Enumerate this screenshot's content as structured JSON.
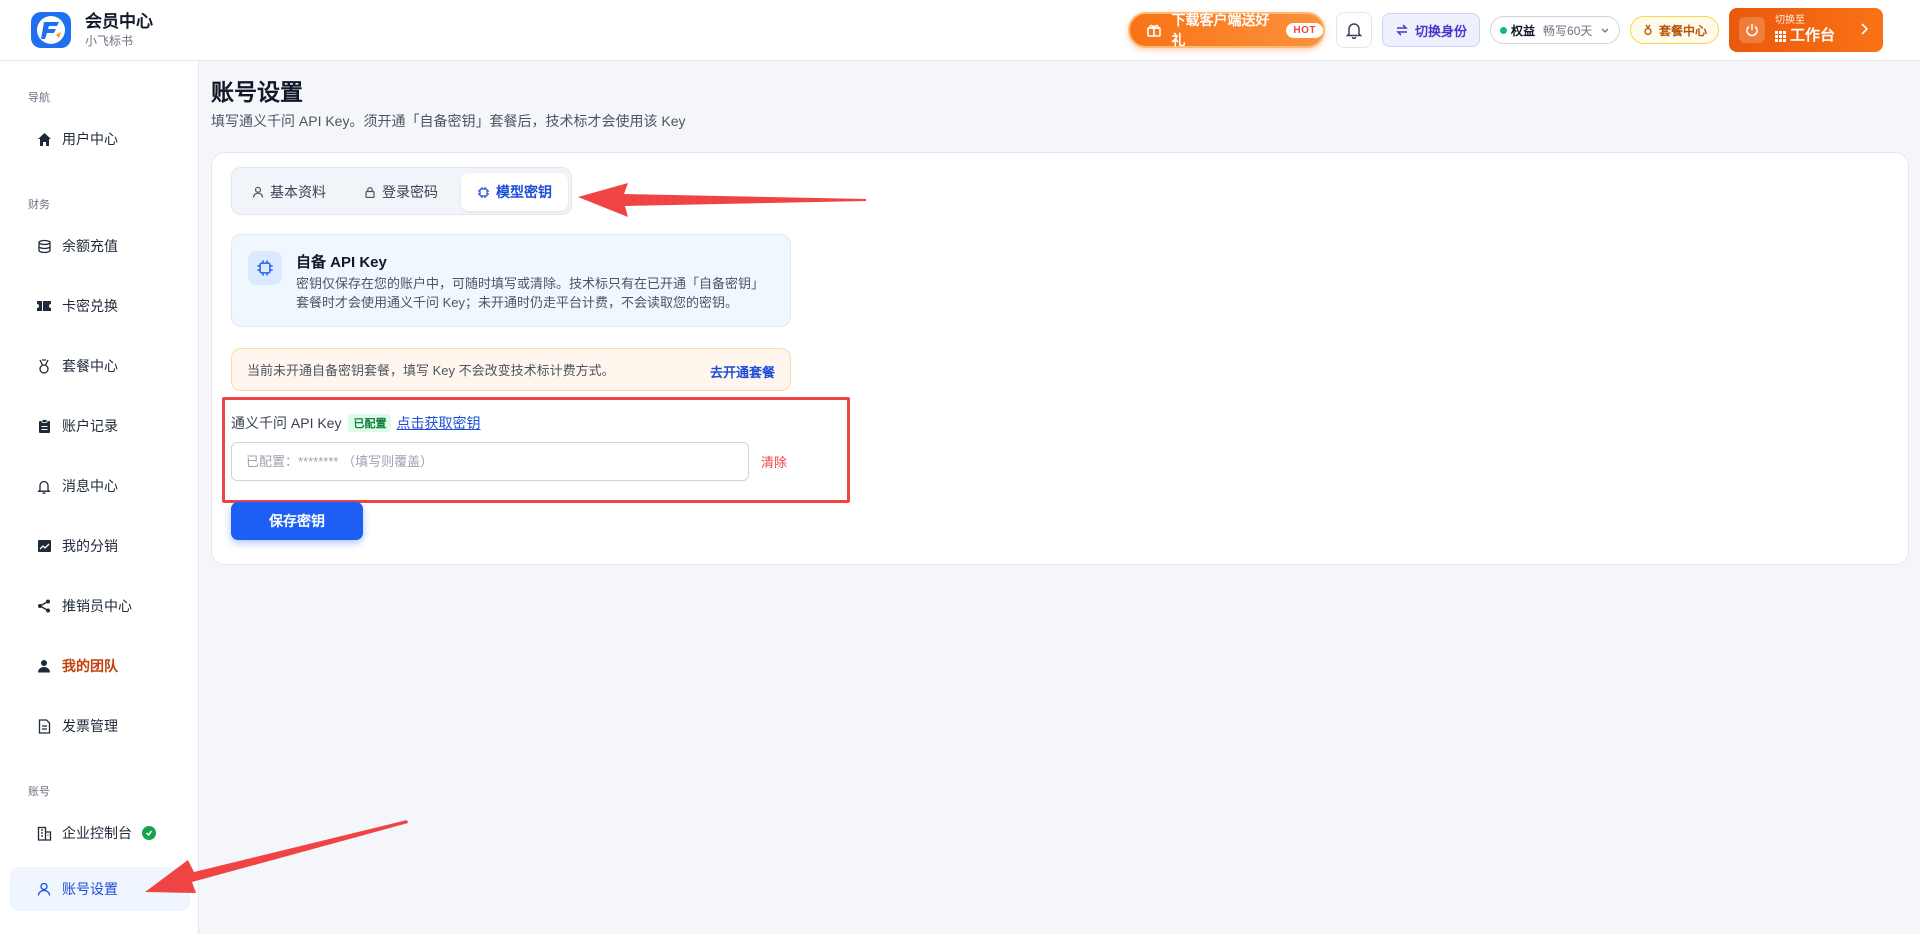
{
  "brand": {
    "title": "会员中心",
    "subtitle": "小飞标书"
  },
  "header": {
    "promo_label": "下载客户端送好礼",
    "promo_badge": "HOT",
    "switch_label": "切换身份",
    "rights_label": "权益",
    "rights_value": "畅写60天",
    "package_label": "套餐中心",
    "workspace_small": "切换至",
    "workspace_big": "工作台"
  },
  "sidebar": {
    "sections": {
      "nav": "导航",
      "finance": "财务",
      "account": "账号"
    },
    "items": [
      {
        "label": "用户中心",
        "icon": "home-icon"
      },
      {
        "label": "余额充值",
        "icon": "database-icon"
      },
      {
        "label": "卡密兑换",
        "icon": "ticket-icon"
      },
      {
        "label": "套餐中心",
        "icon": "medal-icon"
      },
      {
        "label": "账户记录",
        "icon": "clipboard-icon"
      },
      {
        "label": "消息中心",
        "icon": "bell-icon"
      },
      {
        "label": "我的分销",
        "icon": "chart-icon"
      },
      {
        "label": "推销员中心",
        "icon": "share-icon"
      },
      {
        "label": "我的团队",
        "icon": "user-icon"
      },
      {
        "label": "发票管理",
        "icon": "document-icon"
      },
      {
        "label": "企业控制台",
        "icon": "building-icon"
      },
      {
        "label": "账号设置",
        "icon": "user-outline-icon"
      }
    ]
  },
  "page": {
    "title": "账号设置",
    "subtitle": "填写通义千问 API Key。须开通「自备密钥」套餐后，技术标才会使用该 Key"
  },
  "tabs": [
    {
      "label": "基本资料",
      "icon": "user-icon"
    },
    {
      "label": "登录密码",
      "icon": "lock-icon"
    },
    {
      "label": "模型密钥",
      "icon": "chip-icon"
    }
  ],
  "info": {
    "title": "自备 API Key",
    "text": "密钥仅保存在您的账户中，可随时填写或清除。技术标只有在已开通「自备密钥」套餐时才会使用通义千问 Key；未开通时仍走平台计费，不会读取您的密钥。"
  },
  "notice": {
    "text": "当前未开通自备密钥套餐，填写 Key 不会改变技术标计费方式。",
    "link": "去开通套餐"
  },
  "form": {
    "label": "通义千问 API Key",
    "status_tag": "已配置",
    "get_key_link": "点击获取密钥",
    "placeholder": "已配置：******** （填写则覆盖）",
    "clear_label": "清除",
    "save_label": "保存密钥"
  },
  "colors": {
    "accent": "#1d5ff5",
    "promo": "#f97316",
    "annotation": "#ef4444"
  }
}
